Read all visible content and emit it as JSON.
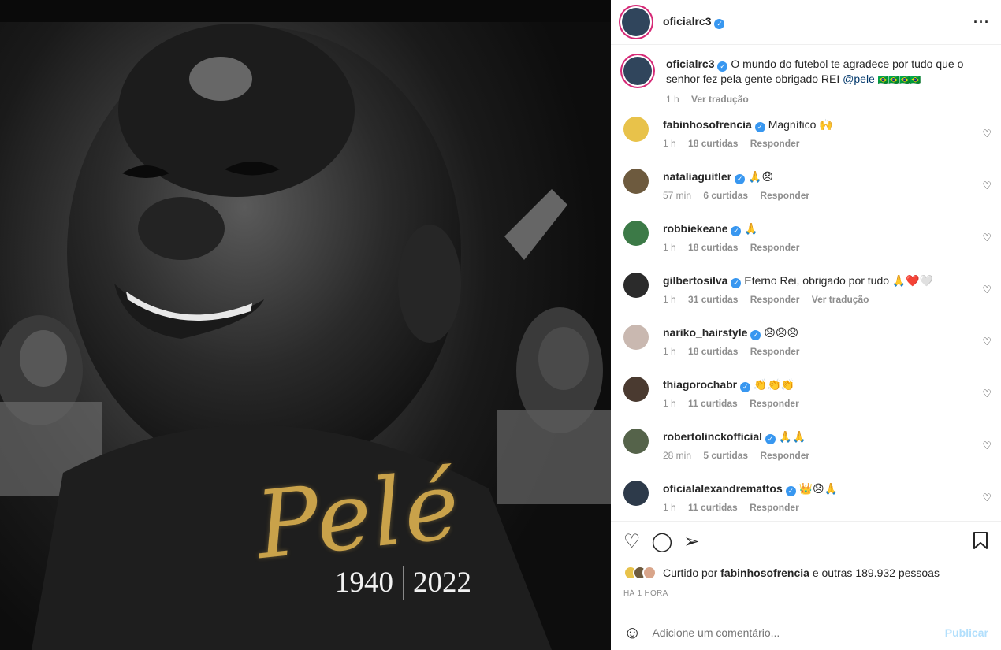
{
  "post": {
    "image_signature": "Pelé",
    "year_start": "1940",
    "year_end": "2022"
  },
  "header": {
    "username": "oficialrc3",
    "more_icon": "more-horizontal-icon"
  },
  "caption": {
    "username": "oficialrc3",
    "text": "O mundo do futebol te agradece por tudo que o senhor fez pela gente obrigado REI",
    "mention": "@pele",
    "suffix": "🇧🇷🇧🇷🇧🇷🇧🇷",
    "time": "1 h",
    "translate": "Ver tradução"
  },
  "comments": [
    {
      "username": "fabinhosofrencia",
      "text": "Magnífico 🙌",
      "time": "1 h",
      "likes": "18 curtidas",
      "reply": "Responder",
      "translate": "",
      "avatar_color": "#e8c24a"
    },
    {
      "username": "nataliaguitler",
      "text": "🙏😞",
      "time": "57 min",
      "likes": "6 curtidas",
      "reply": "Responder",
      "translate": "",
      "avatar_color": "#6d5a3e"
    },
    {
      "username": "robbiekeane",
      "text": "🙏",
      "time": "1 h",
      "likes": "18 curtidas",
      "reply": "Responder",
      "translate": "",
      "avatar_color": "#3c7a47"
    },
    {
      "username": "gilbertosilva",
      "text": "Eterno Rei, obrigado por tudo 🙏❤️🤍",
      "time": "1 h",
      "likes": "31 curtidas",
      "reply": "Responder",
      "translate": "Ver tradução",
      "avatar_color": "#2b2b2b"
    },
    {
      "username": "nariko_hairstyle",
      "text": "😞😞😞",
      "time": "1 h",
      "likes": "18 curtidas",
      "reply": "Responder",
      "translate": "",
      "avatar_color": "#c9b8b0"
    },
    {
      "username": "thiagorochabr",
      "text": "👏👏👏",
      "time": "1 h",
      "likes": "11 curtidas",
      "reply": "Responder",
      "translate": "",
      "avatar_color": "#4a3a30"
    },
    {
      "username": "robertolinckofficial",
      "text": "🙏🙏",
      "time": "28 min",
      "likes": "5 curtidas",
      "reply": "Responder",
      "translate": "",
      "avatar_color": "#55634a"
    },
    {
      "username": "oficialalexandremattos",
      "text": "👑😞🙏",
      "time": "1 h",
      "likes": "11 curtidas",
      "reply": "Responder",
      "translate": "",
      "avatar_color": "#2d3a4a"
    }
  ],
  "actions": {
    "liked_by_prefix": "Curtido por",
    "liked_by_user": "fabinhosofrencia",
    "liked_by_suffix": "e outras 189.932 pessoas",
    "posted_time": "HÁ 1 HORA"
  },
  "add_comment": {
    "placeholder": "Adicione um comentário...",
    "publish": "Publicar"
  },
  "colors": {
    "verified": "#3897f0",
    "publish_disabled": "#b2dffc",
    "signature_gold": "#c9a24a"
  }
}
